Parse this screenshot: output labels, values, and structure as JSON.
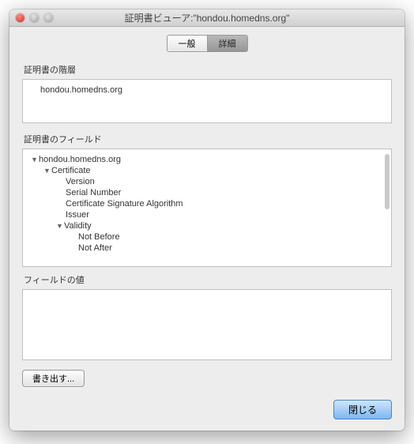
{
  "window": {
    "title": "証明書ビューア:\"hondou.homedns.org\""
  },
  "tabs": {
    "general": "一般",
    "detail": "詳細"
  },
  "labels": {
    "hierarchy": "証明書の階層",
    "fields": "証明書のフィールド",
    "fieldValue": "フィールドの値"
  },
  "hierarchy": {
    "root": "hondou.homedns.org"
  },
  "tree": {
    "root": "hondou.homedns.org",
    "cert": "Certificate",
    "version": "Version",
    "serial": "Serial Number",
    "sigalg": "Certificate Signature Algorithm",
    "issuer": "Issuer",
    "validity": "Validity",
    "notBefore": "Not Before",
    "notAfter": "Not After"
  },
  "buttons": {
    "export": "書き出す...",
    "close": "閉じる"
  }
}
